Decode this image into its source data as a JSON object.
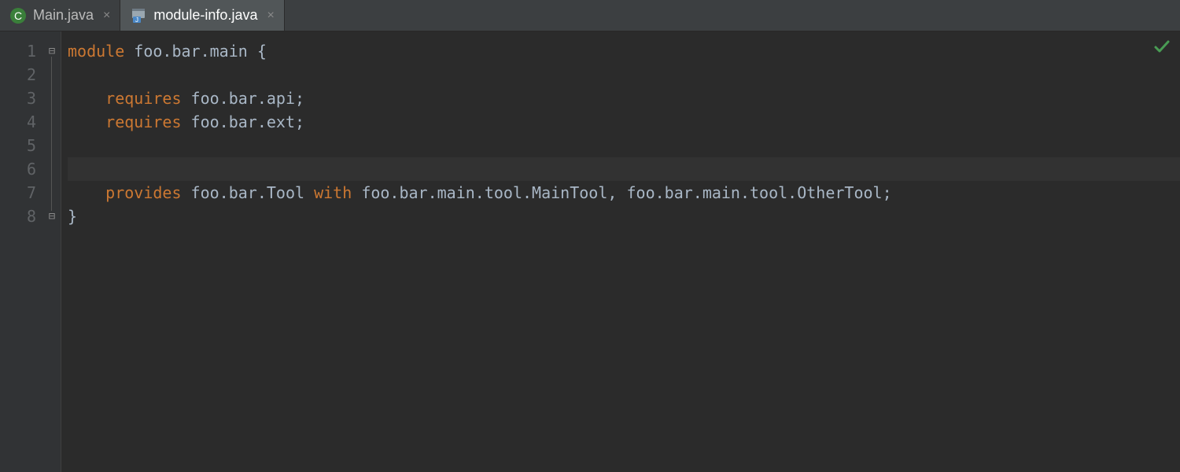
{
  "tabs": [
    {
      "label": "Main.java",
      "icon": "class-icon",
      "active": false
    },
    {
      "label": "module-info.java",
      "icon": "module-icon",
      "active": true
    }
  ],
  "gutter": {
    "start": 1,
    "end": 8
  },
  "fold": {
    "open_line": 1,
    "close_line": 8
  },
  "caret_line": 6,
  "status_check": "✓",
  "code_lines": [
    [
      {
        "t": "module ",
        "c": "kw"
      },
      {
        "t": "foo.bar.main ",
        "c": "id"
      },
      {
        "t": "{",
        "c": "punc"
      }
    ],
    [],
    [
      {
        "t": "    ",
        "c": "id"
      },
      {
        "t": "requires ",
        "c": "kw"
      },
      {
        "t": "foo.bar.api",
        "c": "id"
      },
      {
        "t": ";",
        "c": "punc"
      }
    ],
    [
      {
        "t": "    ",
        "c": "id"
      },
      {
        "t": "requires ",
        "c": "kw"
      },
      {
        "t": "foo.bar.ext",
        "c": "id"
      },
      {
        "t": ";",
        "c": "punc"
      }
    ],
    [],
    [],
    [
      {
        "t": "    ",
        "c": "id"
      },
      {
        "t": "provides ",
        "c": "kw"
      },
      {
        "t": "foo.bar.Tool ",
        "c": "id"
      },
      {
        "t": "with ",
        "c": "kw"
      },
      {
        "t": "foo.bar.main.tool.MainTool",
        "c": "id"
      },
      {
        "t": ", ",
        "c": "punc"
      },
      {
        "t": "foo.bar.main.tool.OtherTool",
        "c": "id"
      },
      {
        "t": ";",
        "c": "punc"
      }
    ],
    [
      {
        "t": "}",
        "c": "punc"
      }
    ]
  ]
}
